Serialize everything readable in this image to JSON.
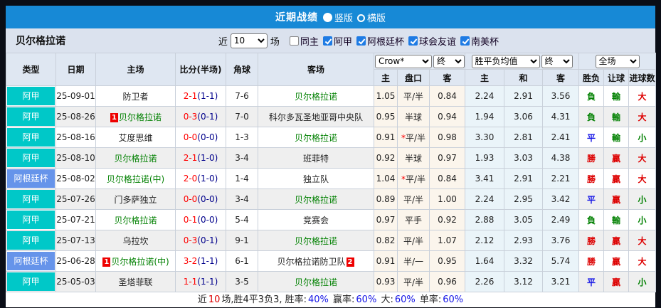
{
  "titlebar": {
    "title": "近期战绩",
    "radios": [
      {
        "label": "竖版",
        "selected": true
      },
      {
        "label": "横版",
        "selected": false
      }
    ]
  },
  "filterbar": {
    "team": "贝尔格拉诺",
    "near_label": "近",
    "count_value": "10",
    "unit_label": "场",
    "checkboxes": [
      {
        "label": "同主",
        "checked": false
      },
      {
        "label": "阿甲",
        "checked": true
      },
      {
        "label": "阿根廷杯",
        "checked": true
      },
      {
        "label": "球会友谊",
        "checked": true
      },
      {
        "label": "南美杯",
        "checked": true
      }
    ]
  },
  "table": {
    "headers": {
      "type": "类型",
      "date": "日期",
      "home": "主场",
      "score": "比分(半场)",
      "corner": "角球",
      "away": "客场",
      "odds_company": "Crow*",
      "odds_final": "终",
      "mean_company": "胜平负均值",
      "mean_final": "终",
      "full_select": "全场",
      "odds_home": "主",
      "handicap": "盘口",
      "odds_away": "客",
      "mean_home": "主",
      "mean_draw": "和",
      "mean_away": "客",
      "result": "胜负",
      "handicap_result": "让球",
      "goals": "进球数"
    },
    "rows": [
      {
        "league": "阿甲",
        "league_style": "cyan",
        "date": "25-09-01",
        "home": {
          "name": "防卫者",
          "green": false,
          "badge": "",
          "badge_after": ""
        },
        "score": {
          "full": "2-1",
          "half": "(1-1)"
        },
        "corner": "7-6",
        "away": {
          "name": "贝尔格拉诺",
          "green": true,
          "badge": "",
          "badge_after": ""
        },
        "odds": {
          "home": "1.05",
          "star": "",
          "handicap": "平/半",
          "away": "0.84"
        },
        "mean": {
          "home": "2.24",
          "draw": "2.91",
          "away": "3.56"
        },
        "result": {
          "text": "負",
          "color": "green"
        },
        "spread": {
          "text": "輸",
          "color": "green"
        },
        "goals": {
          "text": "大",
          "color": "red"
        }
      },
      {
        "league": "阿甲",
        "league_style": "cyan",
        "date": "25-08-26",
        "home": {
          "name": "贝尔格拉诺",
          "green": true,
          "badge": "1",
          "badge_after": ""
        },
        "score": {
          "full": "0-3",
          "half": "(0-1)"
        },
        "corner": "7-0",
        "away": {
          "name": "科尔多瓦圣地亚哥中央队",
          "green": false,
          "badge": "",
          "badge_after": ""
        },
        "odds": {
          "home": "0.95",
          "star": "",
          "handicap": "半球",
          "away": "0.94"
        },
        "mean": {
          "home": "1.94",
          "draw": "3.06",
          "away": "4.31"
        },
        "result": {
          "text": "負",
          "color": "green"
        },
        "spread": {
          "text": "輸",
          "color": "green"
        },
        "goals": {
          "text": "大",
          "color": "red"
        }
      },
      {
        "league": "阿甲",
        "league_style": "cyan",
        "date": "25-08-16",
        "home": {
          "name": "艾度思维",
          "green": false,
          "badge": "",
          "badge_after": ""
        },
        "score": {
          "full": "0-0",
          "half": "(0-0)"
        },
        "corner": "1-3",
        "away": {
          "name": "贝尔格拉诺",
          "green": true,
          "badge": "",
          "badge_after": ""
        },
        "odds": {
          "home": "0.91",
          "star": "*",
          "handicap": "平/半",
          "away": "0.98"
        },
        "mean": {
          "home": "3.30",
          "draw": "2.81",
          "away": "2.41"
        },
        "result": {
          "text": "平",
          "color": "blue"
        },
        "spread": {
          "text": "輸",
          "color": "green"
        },
        "goals": {
          "text": "小",
          "color": "green"
        }
      },
      {
        "league": "阿甲",
        "league_style": "cyan",
        "date": "25-08-10",
        "home": {
          "name": "贝尔格拉诺",
          "green": true,
          "badge": "",
          "badge_after": ""
        },
        "score": {
          "full": "2-1",
          "half": "(1-0)"
        },
        "corner": "3-4",
        "away": {
          "name": "班菲特",
          "green": false,
          "badge": "",
          "badge_after": ""
        },
        "odds": {
          "home": "0.92",
          "star": "",
          "handicap": "半球",
          "away": "0.97"
        },
        "mean": {
          "home": "1.93",
          "draw": "3.03",
          "away": "4.38"
        },
        "result": {
          "text": "勝",
          "color": "red"
        },
        "spread": {
          "text": "贏",
          "color": "red"
        },
        "goals": {
          "text": "大",
          "color": "red"
        }
      },
      {
        "league": "阿根廷杯",
        "league_style": "blue",
        "date": "25-08-02",
        "home": {
          "name": "贝尔格拉诺(中)",
          "green": true,
          "badge": "",
          "badge_after": ""
        },
        "score": {
          "full": "2-0",
          "half": "(1-0)"
        },
        "corner": "1-4",
        "away": {
          "name": "独立队",
          "green": false,
          "badge": "",
          "badge_after": ""
        },
        "odds": {
          "home": "1.04",
          "star": "*",
          "handicap": "平/半",
          "away": "0.84"
        },
        "mean": {
          "home": "3.41",
          "draw": "2.91",
          "away": "2.21"
        },
        "result": {
          "text": "勝",
          "color": "red"
        },
        "spread": {
          "text": "贏",
          "color": "red"
        },
        "goals": {
          "text": "大",
          "color": "red"
        }
      },
      {
        "league": "阿甲",
        "league_style": "cyan",
        "date": "25-07-26",
        "home": {
          "name": "门多萨独立",
          "green": false,
          "badge": "",
          "badge_after": ""
        },
        "score": {
          "full": "0-0",
          "half": "(0-0)"
        },
        "corner": "3-4",
        "away": {
          "name": "贝尔格拉诺",
          "green": true,
          "badge": "",
          "badge_after": ""
        },
        "odds": {
          "home": "0.89",
          "star": "",
          "handicap": "平/半",
          "away": "1.00"
        },
        "mean": {
          "home": "2.24",
          "draw": "2.95",
          "away": "3.42"
        },
        "result": {
          "text": "平",
          "color": "blue"
        },
        "spread": {
          "text": "贏",
          "color": "red"
        },
        "goals": {
          "text": "小",
          "color": "green"
        }
      },
      {
        "league": "阿甲",
        "league_style": "cyan",
        "date": "25-07-21",
        "home": {
          "name": "贝尔格拉诺",
          "green": true,
          "badge": "",
          "badge_after": ""
        },
        "score": {
          "full": "0-1",
          "half": "(0-0)"
        },
        "corner": "5-4",
        "away": {
          "name": "竞赛会",
          "green": false,
          "badge": "",
          "badge_after": ""
        },
        "odds": {
          "home": "0.97",
          "star": "",
          "handicap": "平手",
          "away": "0.92"
        },
        "mean": {
          "home": "2.88",
          "draw": "3.05",
          "away": "2.49"
        },
        "result": {
          "text": "負",
          "color": "green"
        },
        "spread": {
          "text": "輸",
          "color": "green"
        },
        "goals": {
          "text": "小",
          "color": "green"
        }
      },
      {
        "league": "阿甲",
        "league_style": "cyan",
        "date": "25-07-13",
        "home": {
          "name": "乌拉坎",
          "green": false,
          "badge": "",
          "badge_after": ""
        },
        "score": {
          "full": "0-3",
          "half": "(0-1)"
        },
        "corner": "9-1",
        "away": {
          "name": "贝尔格拉诺",
          "green": true,
          "badge": "",
          "badge_after": ""
        },
        "odds": {
          "home": "0.82",
          "star": "",
          "handicap": "平/半",
          "away": "1.07"
        },
        "mean": {
          "home": "2.12",
          "draw": "2.93",
          "away": "3.76"
        },
        "result": {
          "text": "勝",
          "color": "red"
        },
        "spread": {
          "text": "贏",
          "color": "red"
        },
        "goals": {
          "text": "大",
          "color": "red"
        }
      },
      {
        "league": "阿根廷杯",
        "league_style": "blue",
        "date": "25-06-28",
        "home": {
          "name": "贝尔格拉诺(中)",
          "green": true,
          "badge": "1",
          "badge_after": ""
        },
        "score": {
          "full": "3-2",
          "half": "(1-1)"
        },
        "corner": "6-1",
        "away": {
          "name": "贝尔格拉诺防卫队",
          "green": false,
          "badge": "",
          "badge_after": "2"
        },
        "odds": {
          "home": "0.91",
          "star": "",
          "handicap": "半/一",
          "away": "0.95"
        },
        "mean": {
          "home": "1.64",
          "draw": "3.32",
          "away": "5.74"
        },
        "result": {
          "text": "勝",
          "color": "red"
        },
        "spread": {
          "text": "贏",
          "color": "red"
        },
        "goals": {
          "text": "大",
          "color": "red"
        }
      },
      {
        "league": "阿甲",
        "league_style": "cyan",
        "date": "25-05-03",
        "home": {
          "name": "圣塔菲联",
          "green": false,
          "badge": "",
          "badge_after": ""
        },
        "score": {
          "full": "1-1",
          "half": "(1-1)"
        },
        "corner": "3-5",
        "away": {
          "name": "贝尔格拉诺",
          "green": true,
          "badge": "",
          "badge_after": ""
        },
        "odds": {
          "home": "0.93",
          "star": "",
          "handicap": "平/半",
          "away": "0.96"
        },
        "mean": {
          "home": "2.26",
          "draw": "3.12",
          "away": "3.21"
        },
        "result": {
          "text": "平",
          "color": "blue"
        },
        "spread": {
          "text": "贏",
          "color": "red"
        },
        "goals": {
          "text": "小",
          "color": "green"
        }
      }
    ]
  },
  "summary": {
    "segments": [
      {
        "text": "近",
        "color": "black"
      },
      {
        "text": "10",
        "color": "red"
      },
      {
        "text": "场,胜4平3负3, 胜率:",
        "color": "black"
      },
      {
        "text": "40%",
        "color": "blue"
      },
      {
        "text": " 赢率:",
        "color": "black"
      },
      {
        "text": "60%",
        "color": "blue"
      },
      {
        "text": " 大:",
        "color": "black"
      },
      {
        "text": "60%",
        "color": "blue"
      },
      {
        "text": " 单率:",
        "color": "black"
      },
      {
        "text": "60%",
        "color": "blue"
      }
    ]
  },
  "colors": {
    "accent_blue": "#1789d6",
    "league_cyan": "#00c8c8",
    "league_blue": "#6694ea",
    "team_green": "#008000",
    "score_red": "#ff0000",
    "half_navy": "#00008b",
    "win_red": "#dd0000",
    "draw_blue": "#1414e6",
    "loss_green": "#008000"
  }
}
